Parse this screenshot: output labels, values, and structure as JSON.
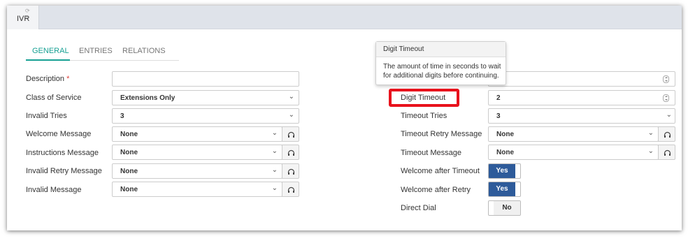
{
  "window_tab": {
    "label": "IVR",
    "icons": "⟳ ×"
  },
  "subtabs": [
    "GENERAL",
    "ENTRIES",
    "RELATIONS"
  ],
  "left_form": {
    "description": {
      "label": "Description",
      "required_mark": "*",
      "value": ""
    },
    "class_of_service": {
      "label": "Class of Service",
      "value": "Extensions Only"
    },
    "invalid_tries": {
      "label": "Invalid Tries",
      "value": "3"
    },
    "welcome_message": {
      "label": "Welcome Message",
      "value": "None"
    },
    "instructions_message": {
      "label": "Instructions Message",
      "value": "None"
    },
    "invalid_retry_message": {
      "label": "Invalid Retry Message",
      "value": "None"
    },
    "invalid_message": {
      "label": "Invalid Message",
      "value": "None"
    }
  },
  "right_form": {
    "digit_timeout": {
      "label": "Digit Timeout",
      "value": "2"
    },
    "timeout_tries": {
      "label": "Timeout Tries",
      "value": "3"
    },
    "timeout_retry_message": {
      "label": "Timeout Retry Message",
      "value": "None"
    },
    "timeout_message": {
      "label": "Timeout Message",
      "value": "None"
    },
    "welcome_after_timeout": {
      "label": "Welcome after Timeout",
      "value": "Yes"
    },
    "welcome_after_retry": {
      "label": "Welcome after Retry",
      "value": "Yes"
    },
    "direct_dial": {
      "label": "Direct Dial",
      "value": "No"
    }
  },
  "tooltip": {
    "title": "Digit Timeout",
    "body": "The amount of time in seconds to wait for additional digits before continuing."
  },
  "colors": {
    "accent": "#17a093",
    "toggle_on": "#2e5b9a",
    "highlight": "#e8121c"
  }
}
